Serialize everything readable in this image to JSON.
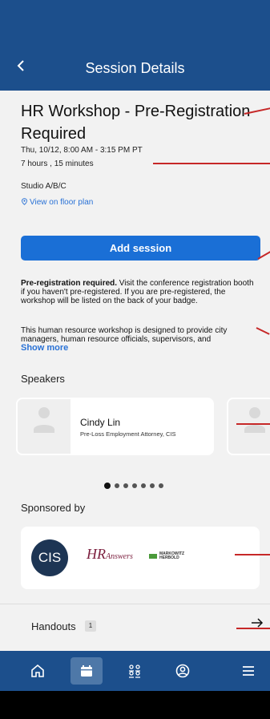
{
  "header": {
    "title": "Session Details",
    "back_icon": "chevron-left-icon"
  },
  "session": {
    "title": "HR Workshop - Pre-Registration Required",
    "datetime": "Thu, 10/12, 8:00 AM - 3:15 PM PT",
    "duration": "7 hours , 15 minutes",
    "room": "Studio A/B/C",
    "floor_plan_link": "View on floor plan",
    "add_button": "Add session"
  },
  "description": {
    "bold_lead": "Pre-registration required.",
    "para1_rest": " Visit the conference registration booth if you haven't pre-registered. If you are pre-registered, the workshop will be listed on the back of your badge.",
    "para2": "This human resource workshop is designed to provide city managers, human resource officials, supervisors, and",
    "show_more": "Show more"
  },
  "speakers": {
    "heading": "Speakers",
    "items": [
      {
        "name": "Cindy Lin",
        "title": "Pre-Loss Employment Attorney, CIS"
      }
    ],
    "carousel": {
      "pages": 7,
      "active": 1
    }
  },
  "sponsors": {
    "heading": "Sponsored by",
    "logos": [
      {
        "text": "CIS"
      },
      {
        "text": "HR",
        "sub": "Answers"
      },
      {
        "text": "MARKOWITZ",
        "sub": "HERBOLD"
      }
    ]
  },
  "handouts": {
    "label": "Handouts",
    "count": "1"
  },
  "tabbar": {
    "items": [
      {
        "icon": "home-icon"
      },
      {
        "icon": "calendar-icon",
        "active": true
      },
      {
        "icon": "people-icon"
      },
      {
        "icon": "profile-icon"
      },
      {
        "icon": "menu-icon"
      }
    ]
  },
  "colors": {
    "header_bg": "#1c4f8c",
    "primary_button": "#1a6fd6",
    "link": "#2a72d6",
    "annotation": "#c62828"
  }
}
